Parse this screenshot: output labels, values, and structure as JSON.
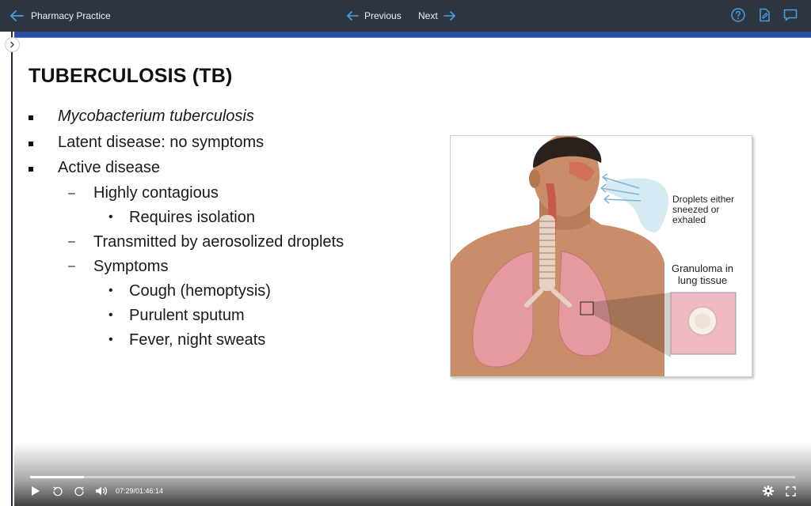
{
  "app": {
    "title": "Pharmacy Practice",
    "nav": {
      "previous": "Previous",
      "next": "Next"
    }
  },
  "icons": {
    "back": "arrow-left-icon",
    "help": "help-circle-icon",
    "notes": "edit-document-icon",
    "comments": "comment-icon",
    "collapse": "chevron-right-icon"
  },
  "slide": {
    "title": "TUBERCULOSIS (TB)",
    "bullets": [
      {
        "level": 1,
        "text": "Mycobacterium tuberculosis",
        "italic": true
      },
      {
        "level": 1,
        "text": "Latent disease: no symptoms"
      },
      {
        "level": 1,
        "text": "Active disease"
      },
      {
        "level": 2,
        "text": "Highly contagious"
      },
      {
        "level": 3,
        "text": "Requires isolation"
      },
      {
        "level": 2,
        "text": "Transmitted by aerosolized droplets"
      },
      {
        "level": 2,
        "text": "Symptoms"
      },
      {
        "level": 3,
        "text": "Cough (hemoptysis)"
      },
      {
        "level": 3,
        "text": "Purulent sputum"
      },
      {
        "level": 3,
        "text": "Fever, night sweats"
      }
    ],
    "illustration": {
      "droplets_caption": [
        "Droplets either",
        "sneezed or",
        "exhaled"
      ],
      "granuloma_caption": [
        "Granuloma in",
        "lung tissue"
      ]
    }
  },
  "player": {
    "time": "07:29/01:46:14",
    "progress_fraction": 0.07
  },
  "colors": {
    "topbar": "#2d3540",
    "accent": "#4a9fe0",
    "slide_strip": "#2b4f9e"
  }
}
